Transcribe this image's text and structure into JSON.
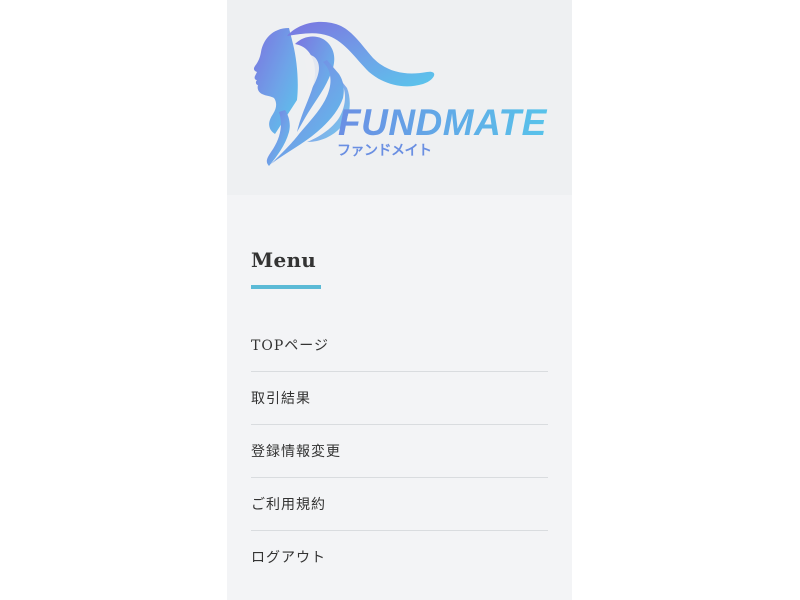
{
  "header": {
    "logo": {
      "brand_text": "FUNDMATE",
      "brand_kana": "ファンドメイト",
      "icon": "woman-profile-logo-icon"
    }
  },
  "menu": {
    "title": "Menu",
    "accent_color": "#5bbad6",
    "items": [
      {
        "label": "TOPページ"
      },
      {
        "label": "取引結果"
      },
      {
        "label": "登録情報変更"
      },
      {
        "label": "ご利用規約"
      },
      {
        "label": "ログアウト"
      }
    ]
  }
}
